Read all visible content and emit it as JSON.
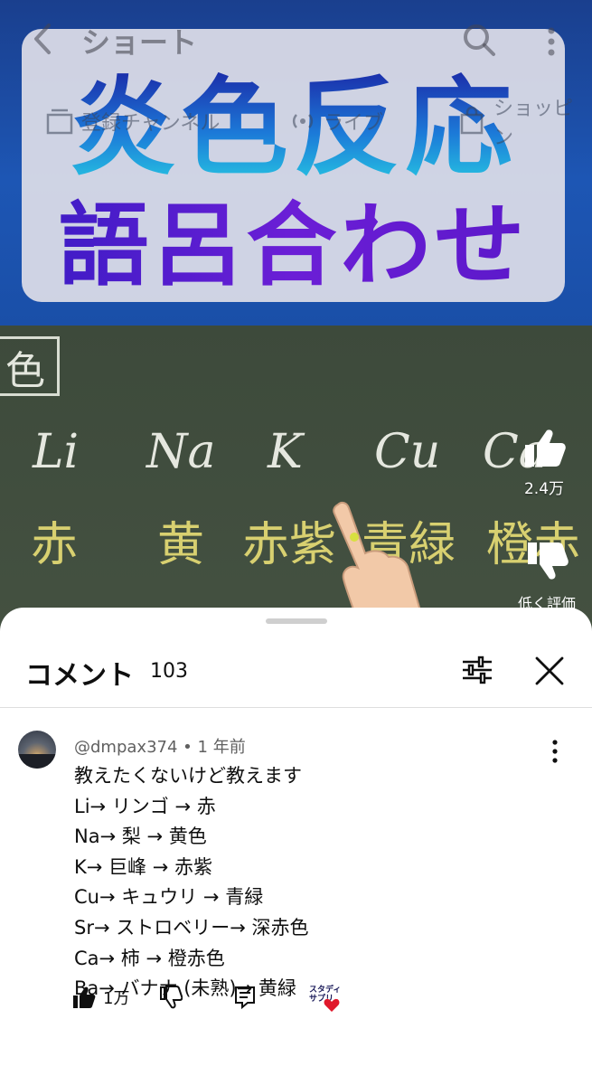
{
  "header": {
    "back_icon": "chevron-left-icon",
    "title": "ショート",
    "search_icon": "search-icon",
    "more_icon": "more-vertical-icon"
  },
  "chips": [
    {
      "label": "登録チャンネル",
      "icon": "subscriptions-icon"
    },
    {
      "label": "ライブ",
      "icon": "live-icon"
    },
    {
      "label": "ショッピン",
      "icon": "shopping-bag-icon"
    }
  ],
  "video": {
    "overlay_title_top": "炎色反応",
    "overlay_title_bottom": "語呂合わせ",
    "board_char": "色",
    "elements": [
      "Li",
      "Na",
      "K",
      "Cu",
      "Ca"
    ],
    "flame_colors": [
      "赤",
      "黄",
      "赤紫",
      "青緑",
      "橙赤"
    ],
    "like_count": "2.4万",
    "dislike_label": "低く評価"
  },
  "comments_sheet": {
    "title": "コメント",
    "count": "103",
    "filter_icon": "sliders-icon",
    "close_icon": "close-icon",
    "comment": {
      "author": "@dmpax374",
      "time": "1 年前",
      "lines": [
        "教えたくないけど教えます",
        "Li→ リンゴ → 赤",
        "Na→ 梨 → 黄色",
        "K→ 巨峰 → 赤紫",
        "Cu→ キュウリ → 青緑",
        "Sr→ ストロベリー→ 深赤色",
        "Ca→ 柿 → 橙赤色",
        "Ba→ バナナ (未熟)→ 黄緑"
      ],
      "like_count": "1万",
      "creator_badge_text": "スタディ サプリ"
    }
  },
  "colors": {
    "video_blue": "#1d56b4",
    "board_green": "#3f4a3c",
    "chalk_yellow": "#d8d070",
    "heart_red": "#e0182b",
    "text_primary": "#0f0f0f",
    "text_secondary": "#606060"
  }
}
